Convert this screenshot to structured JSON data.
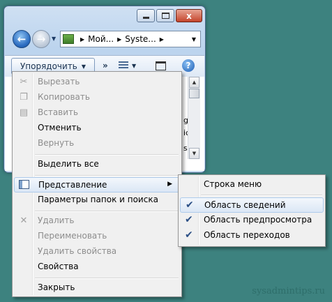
{
  "window": {
    "close_glyph": "x",
    "address": {
      "crumbs": [
        "Мой...",
        "Syste..."
      ]
    },
    "toolbar": {
      "organize_label": "Упорядочить",
      "more_glyph": "»"
    },
    "content_fragments": [
      "g",
      "ic",
      "s"
    ]
  },
  "menu": {
    "items": [
      {
        "label": "Вырезать",
        "enabled": false,
        "icon": "scissors-icon"
      },
      {
        "label": "Копировать",
        "enabled": false,
        "icon": "copy-icon"
      },
      {
        "label": "Вставить",
        "enabled": false,
        "icon": "paste-icon"
      },
      {
        "label": "Отменить",
        "enabled": true
      },
      {
        "label": "Вернуть",
        "enabled": false
      },
      {
        "label": "Выделить все",
        "enabled": true
      },
      {
        "label": "Представление",
        "enabled": true,
        "icon": "layout-icon",
        "has_submenu": true,
        "highlighted": true
      },
      {
        "label": "Параметры папок и поиска",
        "enabled": true
      },
      {
        "label": "Удалить",
        "enabled": false,
        "icon": "delete-icon"
      },
      {
        "label": "Переименовать",
        "enabled": false
      },
      {
        "label": "Удалить свойства",
        "enabled": false
      },
      {
        "label": "Свойства",
        "enabled": true
      },
      {
        "label": "Закрыть",
        "enabled": true
      }
    ]
  },
  "submenu": {
    "items": [
      {
        "label": "Строка меню",
        "checked": false
      },
      {
        "label": "Область сведений",
        "checked": true,
        "highlighted": true
      },
      {
        "label": "Область предпросмотра",
        "checked": true
      },
      {
        "label": "Область переходов",
        "checked": true
      }
    ]
  },
  "watermark": "sysadmintips.ru",
  "colors": {
    "desktop": "#3d827f",
    "menu_bg": "#f0f0f0",
    "highlight_border": "#aecbeb",
    "disabled_text": "#8d8d8d"
  }
}
